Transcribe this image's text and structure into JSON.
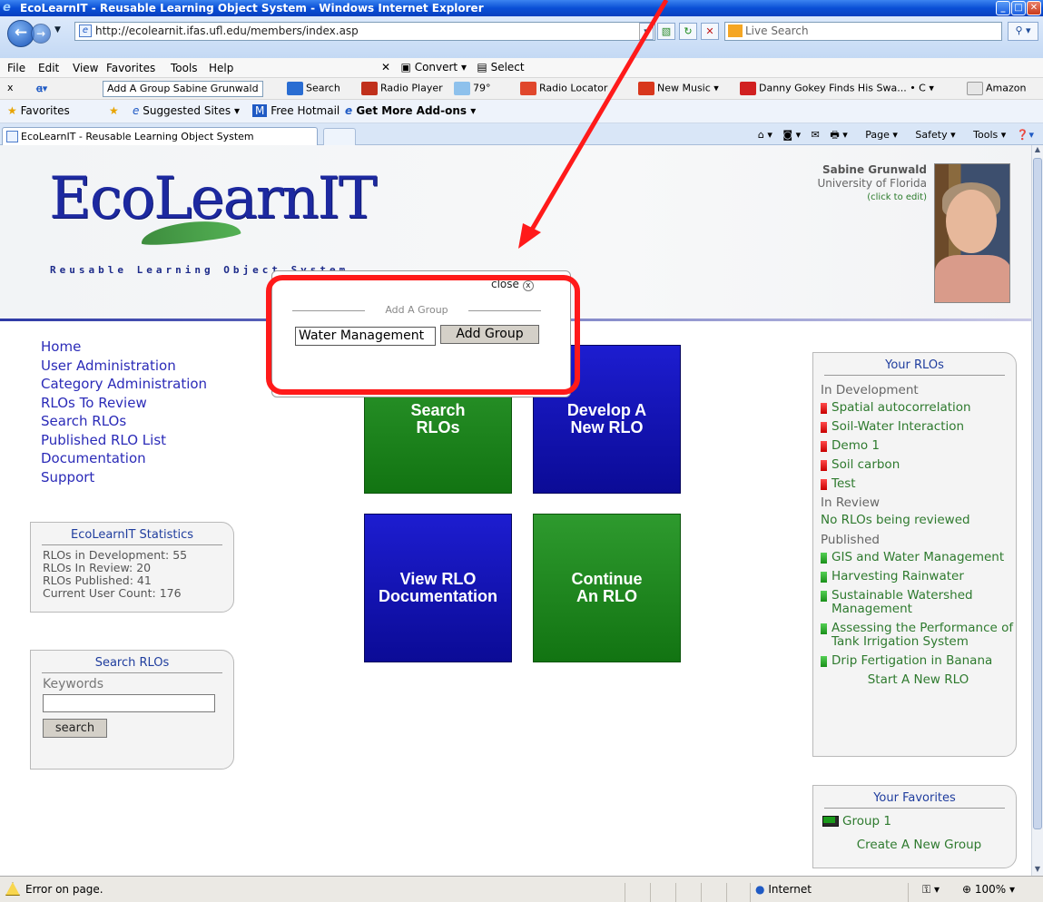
{
  "window": {
    "title": "EcoLearnIT - Reusable Learning Object System - Windows Internet Explorer",
    "buttons": [
      "_",
      "□",
      "✕"
    ]
  },
  "address": {
    "url": "http://ecolearnit.ifas.ufl.edu/members/index.asp",
    "search_placeholder": "Live Search"
  },
  "menubar": {
    "items": [
      "File",
      "Edit",
      "View",
      "Favorites",
      "Tools",
      "Help"
    ],
    "convert": "Convert",
    "select": "Select"
  },
  "toolbar2": {
    "close": "x",
    "addon_select": "Add A Group  Sabine Grunwald",
    "search": "Search",
    "radio_player": "Radio Player",
    "weather": "79°",
    "radio_locator": "Radio Locator",
    "new_music": "New Music",
    "news": "Danny Gokey Finds His Swa... • C",
    "amazon": "Amazon"
  },
  "favbar": {
    "favorites": "Favorites",
    "suggested": "Suggested Sites",
    "hotmail": "Free Hotmail",
    "addons": "Get More Add-ons"
  },
  "tab": {
    "label": "EcoLearnIT - Reusable Learning Object System"
  },
  "commandbar": {
    "page": "Page",
    "safety": "Safety",
    "tools": "Tools"
  },
  "header": {
    "logo": "EcoLearnIT",
    "tagline": "Reusable Learning Object System"
  },
  "user": {
    "name": "Sabine Grunwald",
    "university": "University of Florida",
    "edit": "(click to edit)"
  },
  "nav": {
    "items": [
      "Home",
      "User Administration",
      "Category Administration",
      "RLOs To Review",
      "Search RLOs",
      "Published RLO List",
      "Documentation",
      "Support"
    ]
  },
  "stats": {
    "title": "EcoLearnIT Statistics",
    "lines": [
      "RLOs in Development: 55",
      "RLOs In Review: 20",
      "RLOs Published: 41",
      "Current User Count: 176"
    ]
  },
  "search": {
    "title": "Search RLOs",
    "keywords_label": "Keywords",
    "button": "search"
  },
  "tiles": {
    "search": [
      "Search",
      "RLOs"
    ],
    "develop": [
      "Develop A",
      "New RLO"
    ],
    "view": [
      "View RLO",
      "Documentation"
    ],
    "continue": [
      "Continue",
      "An RLO"
    ]
  },
  "rlos": {
    "title": "Your RLOs",
    "in_development_label": "In Development",
    "in_development": [
      "Spatial autocorrelation",
      "Soil-Water Interaction",
      "Demo 1",
      "Soil carbon",
      "Test"
    ],
    "in_review_label": "In Review",
    "in_review_text": "No RLOs being reviewed",
    "published_label": "Published",
    "published": [
      "GIS and Water Management",
      "Harvesting Rainwater",
      "Sustainable Watershed Management",
      "Assessing the Performance of Tank Irrigation System",
      "Drip Fertigation in Banana"
    ],
    "start_new": "Start A New RLO"
  },
  "favorites": {
    "title": "Your Favorites",
    "items": [
      "Group 1"
    ],
    "create": "Create A New Group"
  },
  "popup": {
    "close": "close",
    "legend": "Add A Group",
    "input_value": "Water Management",
    "button": "Add Group"
  },
  "status": {
    "message": "Error on page.",
    "zone": "Internet",
    "zoom": "100%"
  },
  "colors": {
    "annotation": "#ff1a1a",
    "tile_green": "#1a861a",
    "tile_blue": "#1111b8",
    "link_blue": "#2b2bb8",
    "link_green": "#2e7a2e"
  }
}
